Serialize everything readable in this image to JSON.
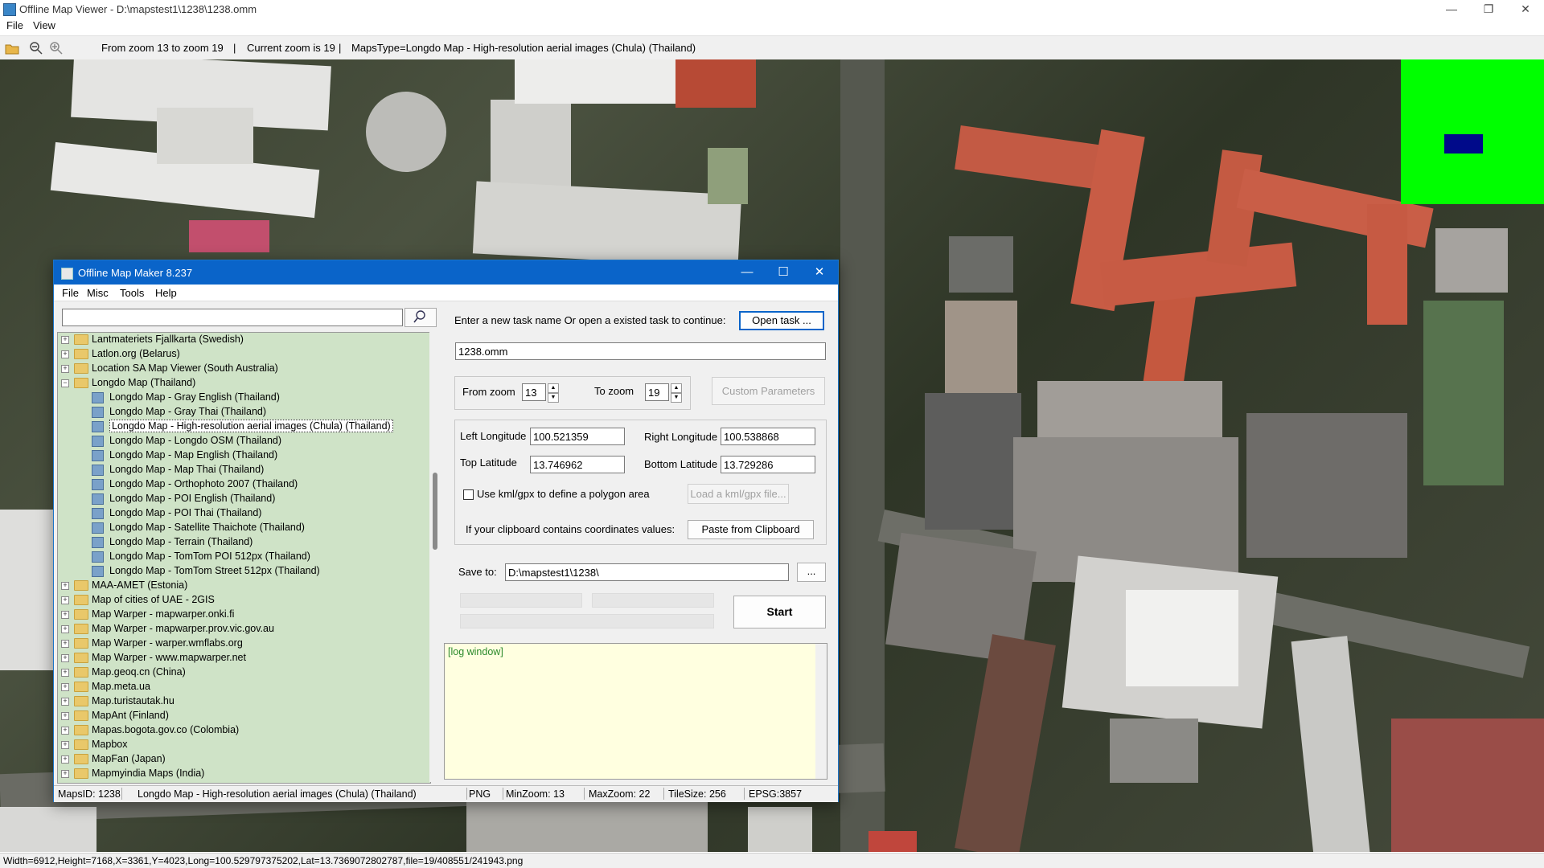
{
  "window": {
    "title": "Offline Map Viewer - D:\\mapstest1\\1238\\1238.omm",
    "controls": {
      "minimize": "—",
      "maximize": "❐",
      "close": "✕"
    }
  },
  "menu": {
    "file": "File",
    "view": "View"
  },
  "toolbar": {
    "zoom_range": "From zoom 13 to zoom 19",
    "current_zoom": "Current zoom is 19",
    "maps_type": "MapsType=Longdo Map - High-resolution aerial images (Chula) (Thailand)",
    "icons": [
      "open-folder-icon",
      "zoom-out-icon",
      "zoom-in-icon"
    ]
  },
  "statusbar": {
    "text": "Width=6912,Height=7168,X=3361,Y=4023,Long=100.529797375202,Lat=13.7369072802787,file=19/408551/241943.png"
  },
  "minimap": {
    "bg_color": "#00ff00",
    "viewport_color": "#000a8a"
  },
  "dialog": {
    "title": "Offline Map Maker 8.237",
    "controls": {
      "minimize": "—",
      "maximize": "☐",
      "close": "✕"
    },
    "menu": {
      "file": "File",
      "misc": "Misc",
      "tools": "Tools",
      "help": "Help"
    },
    "search": {
      "value": "",
      "button_icon": "search-icon"
    },
    "tree": [
      {
        "label": "Lantmateriets Fjallkarta (Swedish)",
        "level": 0,
        "expanded": false
      },
      {
        "label": "Latlon.org (Belarus)",
        "level": 0,
        "expanded": false
      },
      {
        "label": "Location SA Map Viewer (South Australia)",
        "level": 0,
        "expanded": false
      },
      {
        "label": "Longdo Map (Thailand)",
        "level": 0,
        "expanded": true
      },
      {
        "label": "Longdo Map - Gray English (Thailand)",
        "level": 1
      },
      {
        "label": "Longdo Map - Gray Thai (Thailand)",
        "level": 1
      },
      {
        "label": "Longdo Map - High-resolution aerial images (Chula) (Thailand)",
        "level": 1,
        "selected": true
      },
      {
        "label": "Longdo Map - Longdo OSM (Thailand)",
        "level": 1
      },
      {
        "label": "Longdo Map - Map English (Thailand)",
        "level": 1
      },
      {
        "label": "Longdo Map - Map Thai (Thailand)",
        "level": 1
      },
      {
        "label": "Longdo Map - Orthophoto 2007 (Thailand)",
        "level": 1
      },
      {
        "label": "Longdo Map - POI English (Thailand)",
        "level": 1
      },
      {
        "label": "Longdo Map - POI Thai (Thailand)",
        "level": 1
      },
      {
        "label": "Longdo Map - Satellite Thaichote (Thailand)",
        "level": 1
      },
      {
        "label": "Longdo Map - Terrain (Thailand)",
        "level": 1
      },
      {
        "label": "Longdo Map - TomTom POI 512px (Thailand)",
        "level": 1
      },
      {
        "label": "Longdo Map - TomTom Street 512px (Thailand)",
        "level": 1
      },
      {
        "label": "MAA-AMET (Estonia)",
        "level": 0,
        "expanded": false
      },
      {
        "label": "Map of cities of UAE - 2GIS",
        "level": 0,
        "expanded": false
      },
      {
        "label": "Map Warper - mapwarper.onki.fi",
        "level": 0,
        "expanded": false
      },
      {
        "label": "Map Warper - mapwarper.prov.vic.gov.au",
        "level": 0,
        "expanded": false
      },
      {
        "label": "Map Warper - warper.wmflabs.org",
        "level": 0,
        "expanded": false
      },
      {
        "label": "Map Warper - www.mapwarper.net",
        "level": 0,
        "expanded": false
      },
      {
        "label": "Map.geoq.cn (China)",
        "level": 0,
        "expanded": false
      },
      {
        "label": "Map.meta.ua",
        "level": 0,
        "expanded": false
      },
      {
        "label": "Map.turistautak.hu",
        "level": 0,
        "expanded": false
      },
      {
        "label": "MapAnt (Finland)",
        "level": 0,
        "expanded": false
      },
      {
        "label": "Mapas.bogota.gov.co (Colombia)",
        "level": 0,
        "expanded": false
      },
      {
        "label": "Mapbox",
        "level": 0,
        "expanded": false
      },
      {
        "label": "MapFan (Japan)",
        "level": 0,
        "expanded": false
      },
      {
        "label": "Mapmyindia Maps (India)",
        "level": 0,
        "expanded": false
      }
    ],
    "task": {
      "prompt": "Enter a new task name Or open a existed task to continue:",
      "open_button": "Open task ...",
      "name": "1238.omm"
    },
    "zoom": {
      "from_label": "From zoom",
      "from_value": "13",
      "to_label": "To zoom",
      "to_value": "19",
      "custom_button": "Custom Parameters"
    },
    "coords": {
      "left_lon_label": "Left Longitude",
      "left_lon": "100.521359",
      "right_lon_label": "Right Longitude",
      "right_lon": "100.538868",
      "top_lat_label": "Top Latitude",
      "top_lat": "13.746962",
      "bottom_lat_label": "Bottom Latitude",
      "bottom_lat": "13.729286",
      "kml_checkbox_label": "Use kml/gpx to define a polygon area",
      "kml_checked": false,
      "kml_button": "Load a kml/gpx file...",
      "clipboard_label": "If your clipboard contains coordinates values:",
      "clipboard_button": "Paste from Clipboard"
    },
    "save": {
      "label": "Save to:",
      "path": "D:\\mapstest1\\1238\\",
      "browse_button": "..."
    },
    "start_button": "Start",
    "log": {
      "text": "[log window]"
    },
    "status": {
      "maps_id": "MapsID: 1238",
      "maps_name": "Longdo Map - High-resolution aerial images (Chula) (Thailand)",
      "format": "PNG",
      "min_zoom": "MinZoom: 13",
      "max_zoom": "MaxZoom: 22",
      "tile_size": "TileSize: 256",
      "epsg": "EPSG:3857"
    }
  }
}
